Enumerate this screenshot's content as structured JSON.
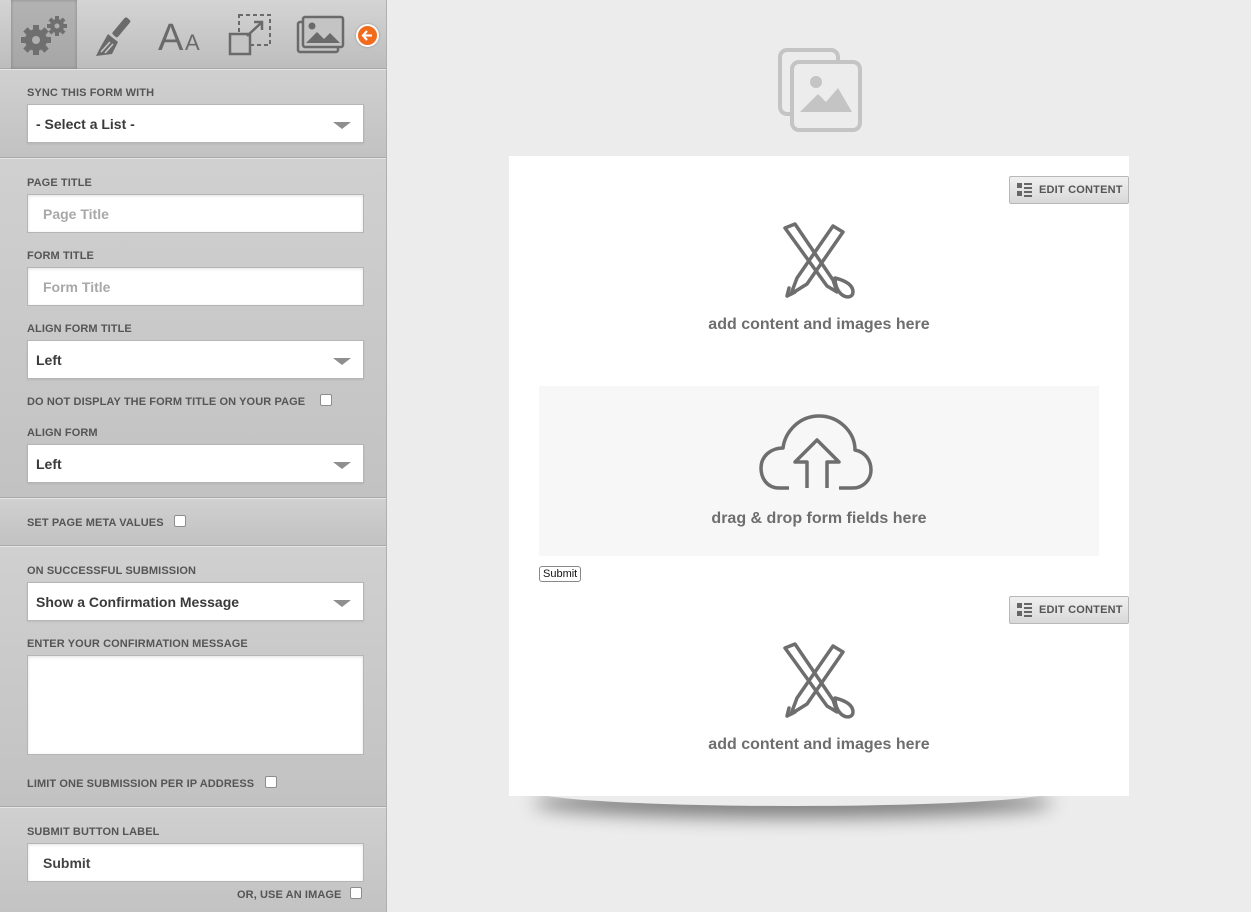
{
  "toolbar": {
    "tools": [
      {
        "name": "settings-icon",
        "active": true
      },
      {
        "name": "brush-icon",
        "active": false
      },
      {
        "name": "text-size-icon",
        "active": false
      },
      {
        "name": "resize-icon",
        "active": false
      },
      {
        "name": "images-icon",
        "active": false
      }
    ],
    "collapse_icon": "arrow-left-icon"
  },
  "sidebar": {
    "sync_label": "SYNC THIS FORM WITH",
    "sync_value": "- Select a List -",
    "page_title_label": "PAGE TITLE",
    "page_title_placeholder": "Page Title",
    "form_title_label": "FORM TITLE",
    "form_title_placeholder": "Form Title",
    "align_form_title_label": "ALIGN FORM TITLE",
    "align_form_title_value": "Left",
    "hide_form_title_label": "DO NOT DISPLAY THE FORM TITLE ON YOUR PAGE",
    "align_form_label": "ALIGN FORM",
    "align_form_value": "Left",
    "meta_label": "SET PAGE META VALUES",
    "on_success_label": "ON SUCCESSFUL SUBMISSION",
    "on_success_value": "Show a Confirmation Message",
    "confirmation_label": "ENTER YOUR CONFIRMATION MESSAGE",
    "confirmation_value": "",
    "limit_label": "LIMIT ONE SUBMISSION PER IP ADDRESS",
    "submit_label_label": "SUBMIT BUTTON LABEL",
    "submit_label_value": "Submit",
    "use_image_label": "OR, USE AN IMAGE"
  },
  "canvas": {
    "edit_content_label": "EDIT CONTENT",
    "content_placeholder": "add content and images here",
    "dropzone_text": "drag & drop form fields here",
    "submit_button": "Submit"
  },
  "colors": {
    "accent": "#f26a1b",
    "sidebar_bg": "#c4c4c4",
    "canvas_bg": "#ececec"
  }
}
